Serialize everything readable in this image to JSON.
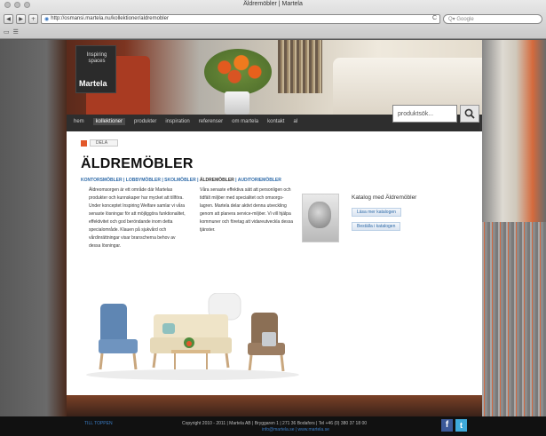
{
  "browser": {
    "window_title": "Äldremöbler | Martela",
    "url": "http://osmansi.martela.nu/kollektioner/aldremobler",
    "search_placeholder": "Q▾ Google",
    "nav_back": "◀",
    "nav_forward": "▶",
    "add": "+",
    "reload": "C"
  },
  "logo": {
    "tagline": "Inspiring spaces",
    "brand": "Martela"
  },
  "nav": {
    "items": [
      "hem",
      "kollektioner",
      "produkter",
      "inspiration",
      "referenser",
      "om martela",
      "kontakt",
      "al"
    ],
    "search_placeholder": "produktsök..."
  },
  "page": {
    "share_label": "DELA",
    "title": "ÄLDREMÖBLER",
    "categories": [
      "KONTORSMÖBLER",
      "LOBBYMÖBLER",
      "SKOLMÖBLER",
      "ÄLDREMÖBLER",
      "AUDITORIEMÖBLER"
    ],
    "body_col1": "Äldreomsorgen är ett område där Martelas produkter och kunnskaper har mycket att tillföra. Under konceptet Inspiring Welfare samlar vi våra senaste lösningar för att möjliggöra funktionalitet, effektivitet och god beröndande inom detta specialområde. Klauen på sjukvård och vårdinrättningar visar branscherna behov av dessa lösningar.",
    "body_col2": "Våra senaste effektiva sätt att personligen och tidfält miljöer med specialitet och omsorgs-lagren. Martela delar aktivt denna utveckling genom att planera service-miljöer. Vi vill hjälpa kommuner och företag att vidareutveckla dessa tjänster.",
    "catalog_heading": "Katalog med Äldremöbler",
    "catalog_btn_view": "Läsa mer katalogen",
    "catalog_btn_order": "Beställa i katalogen"
  },
  "footer": {
    "link_text": "TILL TOPPEN",
    "copyright": "Copyright 2010 - 2011 | Martela AB | Bryggaren 1 | 271 36 Bodafors | Tel +46 (0) 380 37 18 00",
    "email": "info@martela.se | www.martela.se",
    "facebook": "f",
    "twitter": "t"
  },
  "icons": {
    "globe": "globe-icon",
    "search": "magnifier-icon",
    "share": "share-icon"
  },
  "colors": {
    "accent_orange": "#e2582a",
    "link_blue": "#2e6aa8",
    "nav_bg": "#282828"
  }
}
